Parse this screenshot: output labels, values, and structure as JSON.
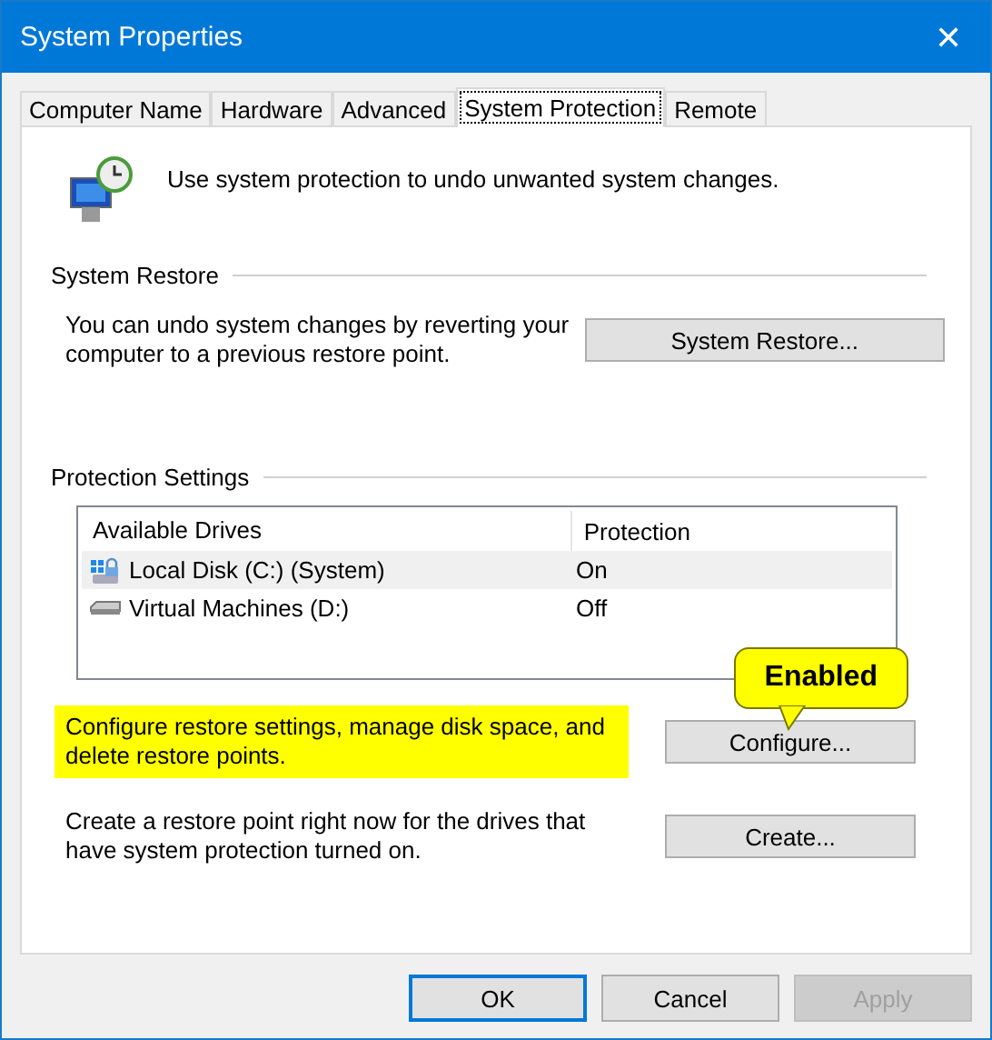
{
  "window": {
    "title": "System Properties",
    "close": "✕"
  },
  "tabs": [
    {
      "label": "Computer Name",
      "selected": false
    },
    {
      "label": "Hardware",
      "selected": false
    },
    {
      "label": "Advanced",
      "selected": false
    },
    {
      "label": "System Protection",
      "selected": true
    },
    {
      "label": "Remote",
      "selected": false
    }
  ],
  "intro": "Use system protection to undo unwanted system changes.",
  "system_restore": {
    "heading": "System Restore",
    "text": "You can undo system changes by reverting your computer to a previous restore point.",
    "button": "System Restore..."
  },
  "protection_settings": {
    "heading": "Protection Settings",
    "columns": [
      "Available Drives",
      "Protection"
    ],
    "rows": [
      {
        "kind": "system",
        "drive": "Local Disk (C:) (System)",
        "protection": "On",
        "selected": true
      },
      {
        "kind": "disk",
        "drive": "Virtual Machines (D:)",
        "protection": "Off",
        "selected": false
      }
    ],
    "actions": [
      {
        "text": "Configure restore settings, manage disk space, and delete restore points.",
        "button": "Configure...",
        "highlighted": true,
        "callout": "Enabled"
      },
      {
        "text": "Create a restore point right now for the drives that have system protection turned on.",
        "button": "Create...",
        "highlighted": false
      }
    ]
  },
  "buttons": [
    {
      "label": "OK",
      "disabled": false,
      "default": true
    },
    {
      "label": "Cancel",
      "disabled": false,
      "default": false
    },
    {
      "label": "Apply",
      "disabled": true,
      "default": false
    }
  ]
}
